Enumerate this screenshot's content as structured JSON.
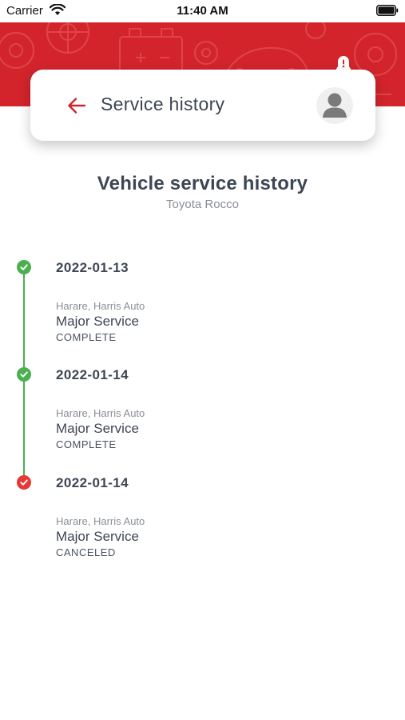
{
  "status_bar": {
    "carrier": "Carrier",
    "time": "11:40 AM",
    "wifi_icon": "wifi-icon",
    "battery_icon": "battery-icon"
  },
  "header": {
    "background_color": "#d3242c",
    "title": "Service history",
    "back_icon": "arrow-left-icon",
    "bell_icon": "bell-alert-icon",
    "avatar_icon": "user-avatar-icon"
  },
  "page": {
    "heading": "Vehicle service history",
    "vehicle": "Toyota Rocco"
  },
  "timeline": {
    "line_color": "#4caf50",
    "entries": [
      {
        "date": "2022-01-13",
        "location": "Harare, Harris Auto",
        "service": "Major Service",
        "status": "COMPLETE",
        "icon": "check-circle-icon",
        "color": "#4caf50"
      },
      {
        "date": "2022-01-14",
        "location": "Harare, Harris Auto",
        "service": "Major Service",
        "status": "COMPLETE",
        "icon": "check-circle-icon",
        "color": "#4caf50"
      },
      {
        "date": "2022-01-14",
        "location": "Harare, Harris Auto",
        "service": "Major Service",
        "status": "CANCELED",
        "icon": "check-circle-icon",
        "color": "#e53935"
      }
    ]
  }
}
